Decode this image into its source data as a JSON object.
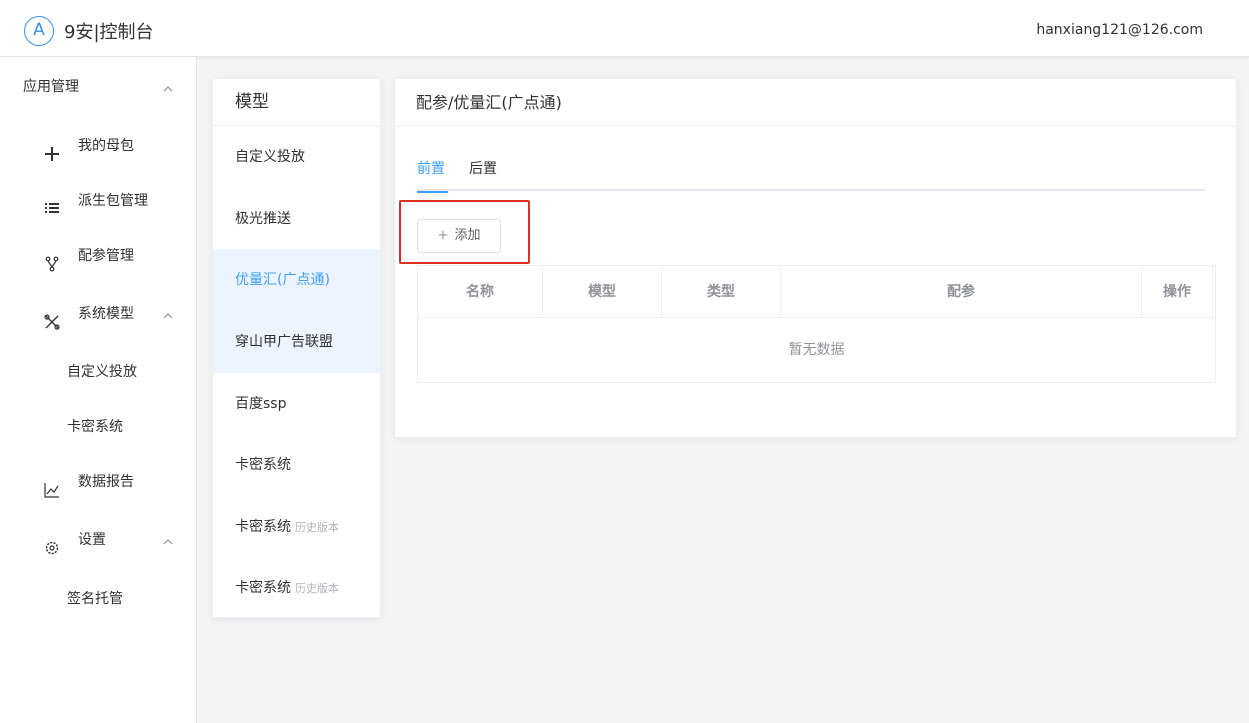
{
  "header": {
    "logo_letter": "A",
    "brand": "9安|控制台",
    "user_email": "hanxiang121@126.com"
  },
  "sidebar": {
    "app_group": "应用管理",
    "items": [
      {
        "label": "我的母包",
        "icon": "plus-icon"
      },
      {
        "label": "派生包管理",
        "icon": "list-icon"
      },
      {
        "label": "配参管理",
        "icon": "branch-icon"
      },
      {
        "label": "系统模型",
        "icon": "tools-icon"
      },
      {
        "label": "数据报告",
        "icon": "chart-line-icon"
      },
      {
        "label": "设置",
        "icon": "gear-icon"
      }
    ],
    "sub_model": [
      "自定义投放",
      "卡密系统"
    ],
    "sub_settings": [
      "签名托管"
    ]
  },
  "models": {
    "title": "模型",
    "items": [
      {
        "label": "自定义投放",
        "tag": ""
      },
      {
        "label": "极光推送",
        "tag": ""
      },
      {
        "label": "优量汇(广点通)",
        "tag": ""
      },
      {
        "label": "穿山甲广告联盟",
        "tag": ""
      },
      {
        "label": "百度ssp",
        "tag": ""
      },
      {
        "label": "卡密系统",
        "tag": ""
      },
      {
        "label": "卡密系统",
        "tag": "历史版本"
      },
      {
        "label": "卡密系统",
        "tag": "历史版本"
      }
    ]
  },
  "main": {
    "title": "配参/优量汇(广点通)",
    "tabs": [
      "前置",
      "后置"
    ],
    "add_label": "添加",
    "columns": [
      "名称",
      "模型",
      "类型",
      "配参",
      "操作"
    ],
    "empty_text": "暂无数据"
  },
  "colors": {
    "accent": "#409eff",
    "highlight_border": "#d93025",
    "active_bg": "#ecf5ff"
  }
}
